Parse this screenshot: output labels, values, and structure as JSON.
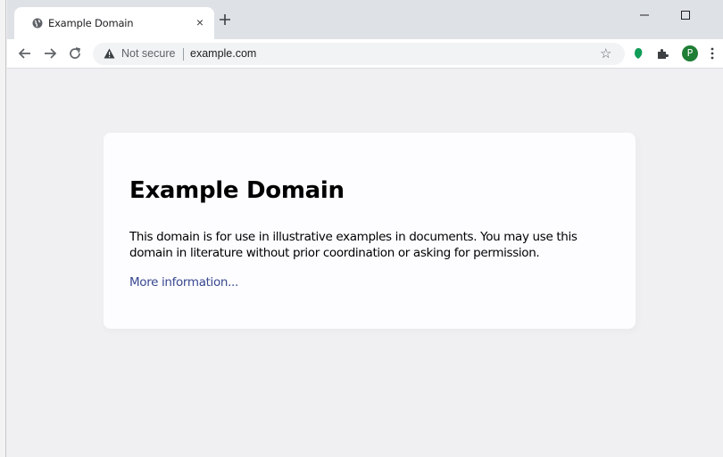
{
  "browser": {
    "tab": {
      "title": "Example Domain",
      "close_label": "×"
    },
    "new_tab_label": "+",
    "toolbar": {
      "security_label": "Not secure",
      "url": "example.com",
      "star_label": "☆",
      "avatar_initial": "P"
    }
  },
  "page": {
    "heading": "Example Domain",
    "description": "This domain is for use in illustrative examples in documents. You may use this domain in literature without prior coordination or asking for permission.",
    "link_text": "More information..."
  },
  "colors": {
    "page_background": "#f0f0f2",
    "card_background": "#fdfdff",
    "link": "#38488f",
    "avatar": "#1e7e34",
    "extension_green": "#0f9d58"
  }
}
